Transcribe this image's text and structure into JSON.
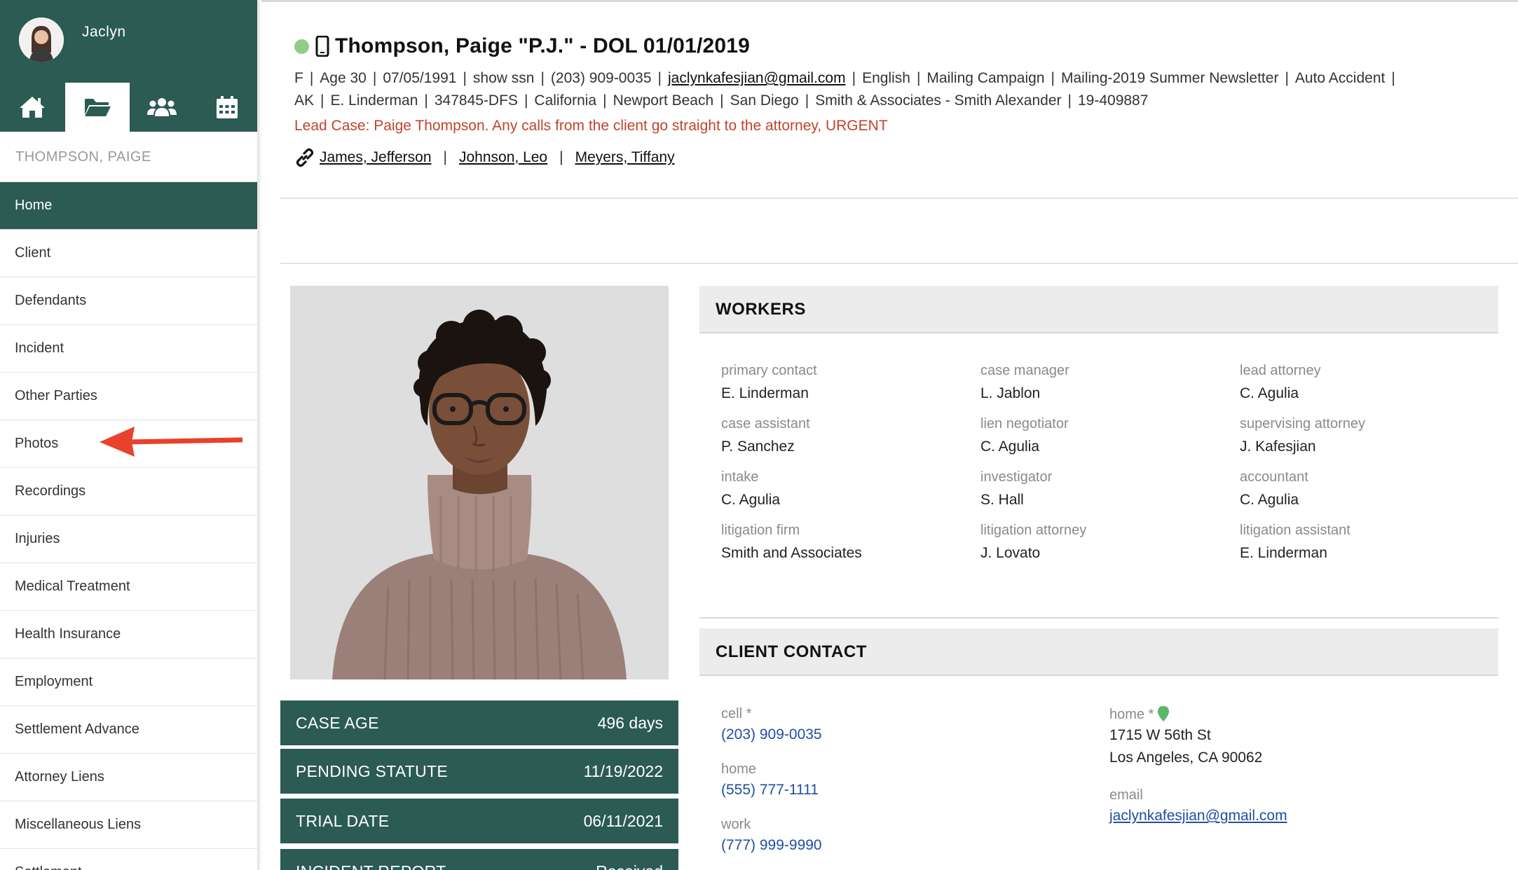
{
  "sidebar": {
    "user_name": "Jaclyn",
    "icons": [
      "home-icon",
      "folder-icon",
      "users-icon",
      "calendar-icon"
    ],
    "case_label": "THOMPSON, PAIGE",
    "items": [
      {
        "label": "Home"
      },
      {
        "label": "Client"
      },
      {
        "label": "Defendants"
      },
      {
        "label": "Incident"
      },
      {
        "label": "Other Parties"
      },
      {
        "label": "Photos"
      },
      {
        "label": "Recordings"
      },
      {
        "label": "Injuries"
      },
      {
        "label": "Medical Treatment"
      },
      {
        "label": "Health Insurance"
      },
      {
        "label": "Employment"
      },
      {
        "label": "Settlement Advance"
      },
      {
        "label": "Attorney Liens"
      },
      {
        "label": "Miscellaneous Liens"
      },
      {
        "label": "Settlement"
      }
    ]
  },
  "header": {
    "title": "Thompson, Paige \"P.J.\" - DOL 01/01/2019",
    "line1": [
      "F",
      "Age 30",
      "07/05/1991",
      "show ssn",
      "(203) 909-0035",
      "jaclynkafesjian@gmail.com",
      "English",
      "Mailing Campaign",
      "Mailing-2019 Summer Newsletter",
      "Auto Accident",
      ""
    ],
    "line2": [
      "AK",
      "E. Linderman",
      "347845-DFS",
      "California",
      "Newport Beach",
      "San Diego",
      "Smith & Associates - Smith Alexander",
      "19-409887"
    ],
    "lead_case": "Lead Case: Paige Thompson. Any calls from the client go straight to the attorney, URGENT",
    "linked": [
      "James, Jefferson",
      "Johnson, Leo",
      "Meyers, Tiffany"
    ]
  },
  "stats": [
    {
      "label": "CASE AGE",
      "value": "496 days"
    },
    {
      "label": "PENDING STATUTE",
      "value": "11/19/2022"
    },
    {
      "label": "TRIAL DATE",
      "value": "06/11/2021"
    },
    {
      "label": "INCIDENT REPORT",
      "value": "Received"
    }
  ],
  "workers": {
    "title": "WORKERS",
    "items": [
      {
        "role": "primary contact",
        "name": "E. Linderman"
      },
      {
        "role": "case manager",
        "name": "L. Jablon"
      },
      {
        "role": "lead attorney",
        "name": "C. Agulia"
      },
      {
        "role": "case assistant",
        "name": "P. Sanchez"
      },
      {
        "role": "lien negotiator",
        "name": "C. Agulia"
      },
      {
        "role": "supervising attorney",
        "name": "J. Kafesjian"
      },
      {
        "role": "intake",
        "name": "C. Agulia"
      },
      {
        "role": "investigator",
        "name": "S. Hall"
      },
      {
        "role": "accountant",
        "name": "C. Agulia"
      },
      {
        "role": "litigation firm",
        "name": "Smith and Associates"
      },
      {
        "role": "litigation attorney",
        "name": "J. Lovato"
      },
      {
        "role": "litigation assistant",
        "name": "E. Linderman"
      }
    ]
  },
  "client_contact": {
    "title": "CLIENT CONTACT",
    "phones": [
      {
        "label": "cell *",
        "value": "(203) 909-0035"
      },
      {
        "label": "home",
        "value": "(555) 777-1111"
      },
      {
        "label": "work",
        "value": "(777) 999-9990"
      }
    ],
    "home_address": {
      "label": "home *",
      "line1": "1715 W 56th St",
      "line2": "Los Angeles, CA 90062"
    },
    "email": {
      "label": "email",
      "value": "jaclynkafesjian@gmail.com"
    }
  },
  "colors": {
    "brand": "#2b5b53",
    "status": "#8fcf85",
    "alert": "#c0442a",
    "link": "#1f4fa0",
    "arrow": "#e8412c"
  }
}
